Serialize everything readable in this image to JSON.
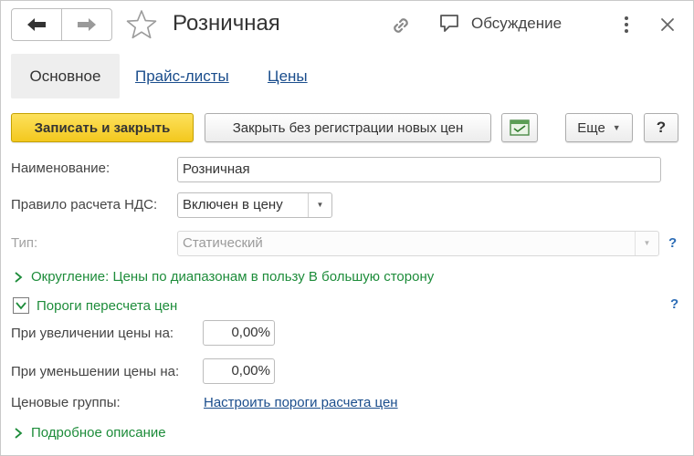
{
  "header": {
    "title": "Розничная",
    "discussion_label": "Обсуждение"
  },
  "tabs": [
    {
      "label": "Основное",
      "active": true
    },
    {
      "label": "Прайс-листы",
      "active": false
    },
    {
      "label": "Цены",
      "active": false
    }
  ],
  "toolbar": {
    "save_close_label": "Записать и закрыть",
    "close_no_reg_label": "Закрыть без регистрации новых цен",
    "more_label": "Еще",
    "help_label": "?"
  },
  "form": {
    "name_label": "Наименование:",
    "name_value": "Розничная",
    "vat_label": "Правило расчета НДС:",
    "vat_value": "Включен в цену",
    "type_label": "Тип:",
    "type_value": "Статический",
    "help_mark": "?",
    "rounding_label": "Округление: Цены по диапазонам в пользу В большую сторону",
    "thresholds_label": "Пороги пересчета цен",
    "increase_label": "При увеличении цены на:",
    "increase_value": "0,00%",
    "decrease_label": "При уменьшении цены на:",
    "decrease_value": "0,00%",
    "price_groups_label": "Ценовые группы:",
    "configure_link": "Настроить пороги расчета цен",
    "details_label": "Подробное описание"
  },
  "colors": {
    "primary_button": "#f3c81e",
    "link": "#1a4d8c",
    "group_green": "#1d8c3a",
    "help_blue": "#2d6db6"
  },
  "icons": [
    "back-arrow-icon",
    "forward-arrow-icon",
    "star-icon",
    "link-icon",
    "discussion-icon",
    "kebab-menu-icon",
    "close-icon",
    "table-icon",
    "chevron-right-icon",
    "chevron-down-icon"
  ]
}
